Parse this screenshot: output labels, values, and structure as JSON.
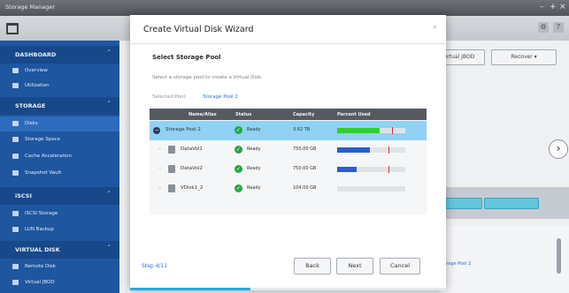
{
  "window": {
    "title": "Storage Manager"
  },
  "toolbar": {
    "icons": [
      "settings-icon",
      "help-icon"
    ]
  },
  "sidebar": {
    "sections": [
      {
        "label": "DASHBOARD",
        "items": [
          "Overview",
          "Utilization"
        ]
      },
      {
        "label": "STORAGE",
        "items": [
          "Disks",
          "Storage Space",
          "Cache Acceleration",
          "Snapshot Vault"
        ]
      },
      {
        "label": "iSCSI",
        "items": [
          "iSCSI Storage",
          "LUN Backup"
        ]
      },
      {
        "label": "VIRTUAL DISK",
        "items": [
          "Remote Disk",
          "Virtual JBOD"
        ]
      }
    ],
    "active_item": "Disks"
  },
  "main": {
    "buttons": [
      "Virtual JBOD",
      "Recover ▾"
    ],
    "pool_link": "Storage Pool 2"
  },
  "wizard": {
    "title": "Create Virtual Disk Wizard",
    "step_title": "Select Storage Pool",
    "description": "Select a storage pool to create a Virtual Disk.",
    "selected_label": "Selected Pool:",
    "selected_value": "Storage Pool 2",
    "columns": [
      "Name/Alias",
      "Status",
      "Capacity",
      "Percent Used"
    ],
    "rows": [
      {
        "name": "Storage Pool 2",
        "status": "Ready",
        "capacity": "3.62 TB",
        "percent_used": 0.62,
        "threshold": 0.8,
        "bar_color": "#2dd12d",
        "selected": true
      },
      {
        "name": "DataVol1",
        "status": "Ready",
        "capacity": "750.00 GB",
        "percent_used": 0.48,
        "threshold": 0.75,
        "bar_color": "#2a5fcf",
        "selected": false
      },
      {
        "name": "DataVol2",
        "status": "Ready",
        "capacity": "750.00 GB",
        "percent_used": 0.28,
        "threshold": 0.75,
        "bar_color": "#2a5fcf",
        "selected": false
      },
      {
        "name": "VDisk1_2",
        "status": "Ready",
        "capacity": "104.00 GB",
        "percent_used": 0.0,
        "threshold": 0.0,
        "bar_color": "#2a5fcf",
        "selected": false
      }
    ],
    "step_counter": "Step 4/11",
    "buttons": {
      "back": "Back",
      "next": "Next",
      "cancel": "Cancel"
    },
    "progress": 0.38
  }
}
